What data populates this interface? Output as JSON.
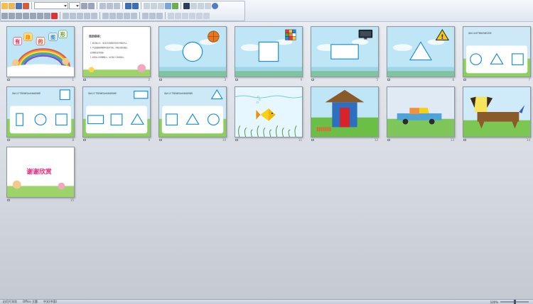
{
  "toolbar": {
    "font_name_value": "",
    "font_size_value": ""
  },
  "slides": [
    {
      "number": "1",
      "type": "title",
      "title_chars": [
        "有",
        "趣",
        "的",
        "图",
        "形"
      ]
    },
    {
      "number": "2",
      "type": "objectives",
      "heading": "活动目标：",
      "lines": [
        "1. 能正确认识、(说出)常见图形的名称并感知特点。",
        "2. 学会根据观察物体的形状特征，拼搭出相应图形。",
        "运用图形变化创编。",
        "3. 培养幼儿的观察能力，动手能力与创造能力。"
      ]
    },
    {
      "number": "3",
      "type": "shape",
      "shape": "circle",
      "object": "basketball-icon"
    },
    {
      "number": "4",
      "type": "shape",
      "shape": "square",
      "object": "rubiks-cube-icon"
    },
    {
      "number": "5",
      "type": "shape",
      "shape": "rectangle",
      "object": "tv-icon"
    },
    {
      "number": "6",
      "type": "shape",
      "shape": "triangle",
      "object": "warning-sign-icon"
    },
    {
      "number": "7",
      "type": "question",
      "question": "请幼儿说出下图中的图形名称",
      "shapes": [
        "circle",
        "triangle",
        "square"
      ]
    },
    {
      "number": "8",
      "type": "question",
      "question": "请幼儿在下面的图形中找出相同图形",
      "target": "square",
      "shapes": [
        "rectangle-tall",
        "circle",
        "square"
      ]
    },
    {
      "number": "9",
      "type": "question",
      "question": "请幼儿在下面的图形中找出相同图形",
      "target": "rectangle",
      "shapes": [
        "rectangle",
        "square",
        "triangle"
      ]
    },
    {
      "number": "10",
      "type": "question",
      "question": "请幼儿在下面的图形中找出相同图形",
      "target": "triangle",
      "shapes": [
        "square",
        "triangle",
        "circle"
      ]
    },
    {
      "number": "11",
      "type": "scene",
      "scene": "fish"
    },
    {
      "number": "12",
      "type": "scene",
      "scene": "house"
    },
    {
      "number": "13",
      "type": "scene",
      "scene": "car"
    },
    {
      "number": "14",
      "type": "scene",
      "scene": "dog"
    },
    {
      "number": "15",
      "type": "end",
      "title": "谢谢欣赏"
    }
  ],
  "status": {
    "view": "幻灯片浏览",
    "theme": "Office 主题",
    "language": "中文(中国)",
    "zoom": "100%"
  },
  "colors": {
    "shape_outline": "#1a8ed6",
    "title_pink": "#e8207a",
    "sky": "#bfe6f7",
    "grass": "#6cbf45"
  }
}
